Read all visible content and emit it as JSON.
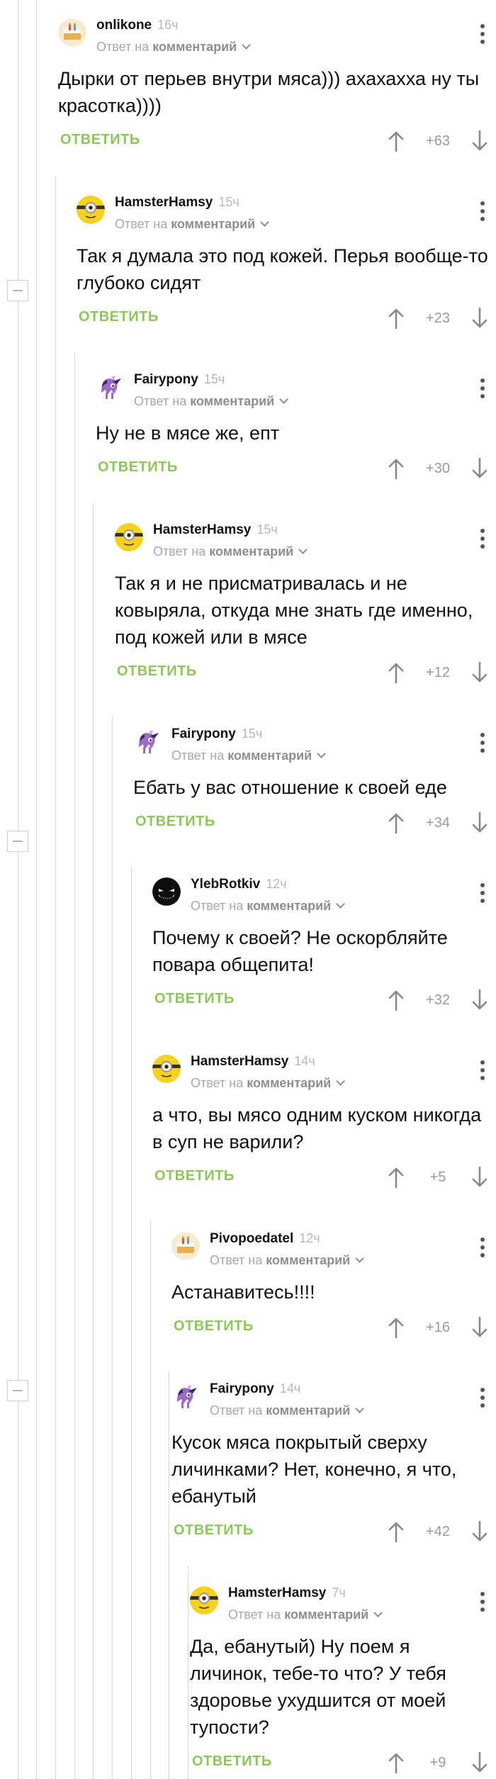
{
  "reply_to": {
    "prefix": "Ответ на",
    "link": "комментарий"
  },
  "reply_label": "ОТВЕТИТЬ",
  "comments": [
    {
      "author": "onlikone",
      "time": "16ч",
      "avatar": "cake-avatar-icon",
      "text": "Дырки от перьев внутри мяса))) ахахахха ну ты красотка))))",
      "score": "+63"
    },
    {
      "author": "HamsterHamsy",
      "time": "15ч",
      "avatar": "minion-avatar-icon",
      "text": "Так я думала это под кожей. Перья вообще-то глубоко сидят",
      "score": "+23"
    },
    {
      "author": "Fairypony",
      "time": "15ч",
      "avatar": "pony-avatar-icon",
      "text": "Ну не в мясе же, епт",
      "score": "+30"
    },
    {
      "author": "HamsterHamsy",
      "time": "15ч",
      "avatar": "minion-avatar-icon",
      "text": "Так я и не присматривалась и не ковыряла, откуда мне знать где именно, под кожей или в мясе",
      "score": "+12"
    },
    {
      "author": "Fairypony",
      "time": "15ч",
      "avatar": "pony-avatar-icon",
      "text": "Ебать у вас отношение к своей еде",
      "score": "+34"
    },
    {
      "author": "YlebRotkiv",
      "time": "12ч",
      "avatar": "grin-avatar-icon",
      "text": "Почему к своей? Не оскорбляйте повара общепита!",
      "score": "+32"
    },
    {
      "author": "HamsterHamsy",
      "time": "14ч",
      "avatar": "minion-avatar-icon",
      "text": "а что, вы мясо одним куском никогда в суп не варили?",
      "score": "+5"
    },
    {
      "author": "Pivopoedatel",
      "time": "12ч",
      "avatar": "cake-avatar-icon",
      "text": "Астанавитесь!!!!",
      "score": "+16"
    },
    {
      "author": "Fairypony",
      "time": "14ч",
      "avatar": "pony-avatar-icon",
      "text": "Кусок мяса покрытый сверху личинками? Нет, конечно, я что, ебанутый",
      "score": "+42"
    },
    {
      "author": "HamsterHamsy",
      "time": "7ч",
      "avatar": "minion-avatar-icon",
      "text": "Да, ебанутый) Ну поем я личинок, тебе-то что? У тебя здоровье ухудшится от моей тупости?",
      "score": "+9"
    }
  ]
}
